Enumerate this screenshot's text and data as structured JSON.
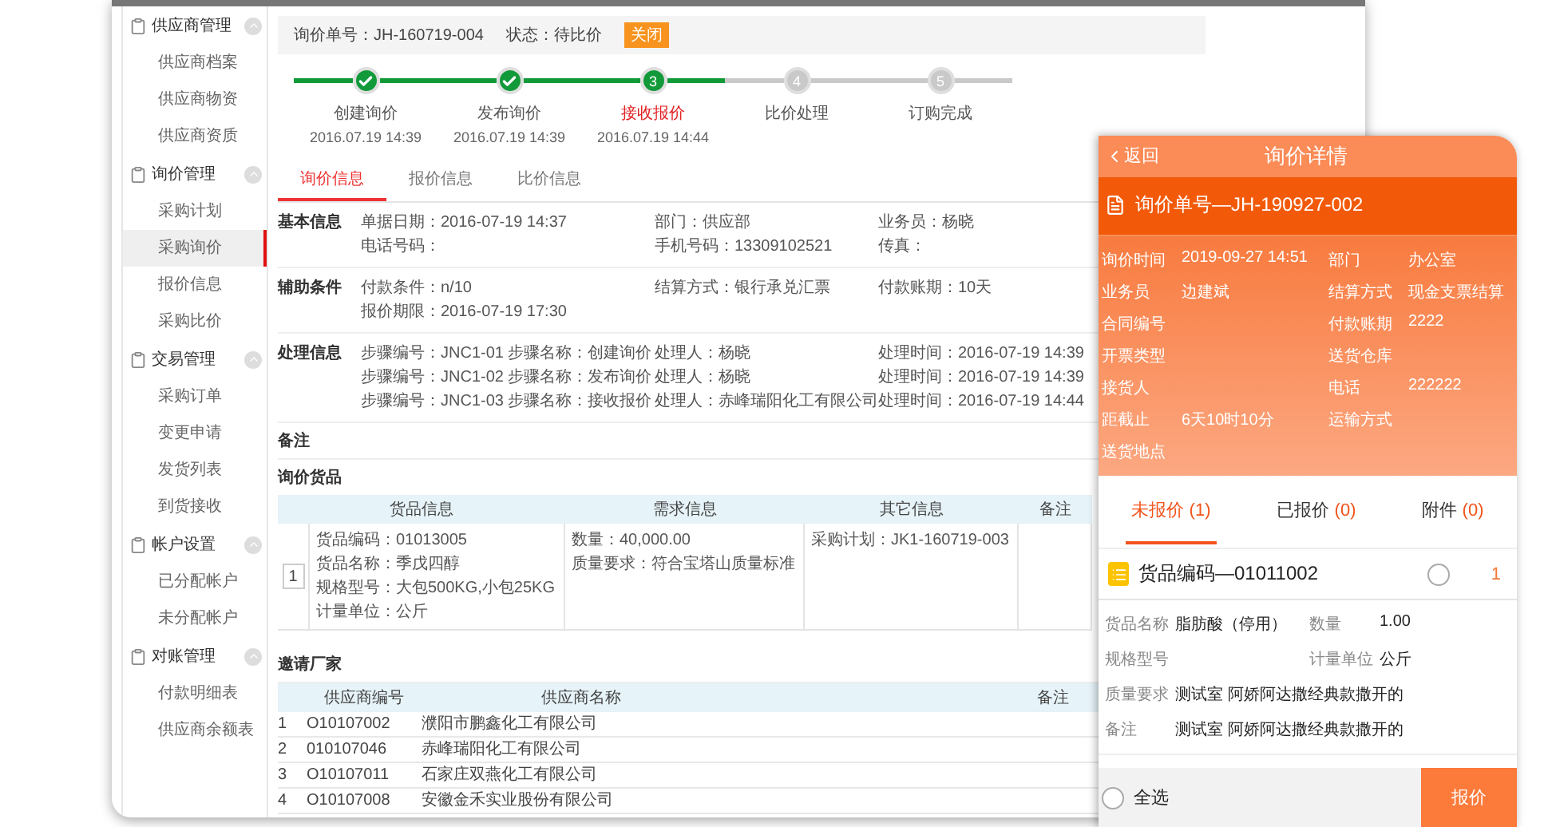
{
  "sidebar": {
    "groups": [
      {
        "title": "供应商管理",
        "expanded": true,
        "items": [
          {
            "label": "供应商档案",
            "selected": false
          },
          {
            "label": "供应商物资",
            "selected": false
          },
          {
            "label": "供应商资质",
            "selected": false
          }
        ]
      },
      {
        "title": "询价管理",
        "expanded": true,
        "items": [
          {
            "label": "采购计划",
            "selected": false
          },
          {
            "label": "采购询价",
            "selected": true
          },
          {
            "label": "报价信息",
            "selected": false
          },
          {
            "label": "采购比价",
            "selected": false
          }
        ]
      },
      {
        "title": "交易管理",
        "expanded": true,
        "items": [
          {
            "label": "采购订单",
            "selected": false
          },
          {
            "label": "变更申请",
            "selected": false
          },
          {
            "label": "发货列表",
            "selected": false
          },
          {
            "label": "到货接收",
            "selected": false
          }
        ]
      },
      {
        "title": "帐户设置",
        "expanded": true,
        "items": [
          {
            "label": "已分配帐户",
            "selected": false
          },
          {
            "label": "未分配帐户",
            "selected": false
          }
        ]
      },
      {
        "title": "对账管理",
        "expanded": true,
        "items": [
          {
            "label": "付款明细表",
            "selected": false
          },
          {
            "label": "供应商余额表",
            "selected": false
          }
        ]
      }
    ]
  },
  "order_bar": {
    "order_no": "询价单号：JH-160719-004",
    "status": "状态：待比价",
    "close_button": "关闭"
  },
  "steps": [
    {
      "done": true,
      "current": false,
      "label": "创建询价",
      "time": "2016.07.19 14:39"
    },
    {
      "done": true,
      "current": false,
      "label": "发布询价",
      "time": "2016.07.19 14:39"
    },
    {
      "done": false,
      "current": true,
      "number": "3",
      "label": "接收报价",
      "time": "2016.07.19 14:44"
    },
    {
      "done": false,
      "current": false,
      "number": "4",
      "label": "比价处理"
    },
    {
      "done": false,
      "current": false,
      "number": "5",
      "label": "订购完成"
    }
  ],
  "tabs": [
    {
      "label": "询价信息",
      "selected": true
    },
    {
      "label": "报价信息",
      "selected": false
    },
    {
      "label": "比价信息",
      "selected": false
    }
  ],
  "sections": [
    {
      "title": "基本信息",
      "kind": "fields",
      "rows": [
        [
          "单据日期：2016-07-19 14:37",
          "部门：供应部",
          "业务员：杨晓"
        ],
        [
          "电话号码：",
          "手机号码：13309102521",
          "传真："
        ]
      ]
    },
    {
      "title": "辅助条件",
      "kind": "fields",
      "rows": [
        [
          "付款条件：n/10",
          "结算方式：银行承兑汇票",
          "付款账期：10天"
        ],
        [
          "报价期限：2016-07-19 17:30"
        ]
      ]
    },
    {
      "title": "处理信息",
      "kind": "steps",
      "rows": [
        [
          "步骤编号：JNC1-01",
          "步骤名称：创建询价",
          "处理人：杨晓",
          "处理时间：2016-07-19 14:39"
        ],
        [
          "步骤编号：JNC1-02",
          "步骤名称：发布询价",
          "处理人：杨晓",
          "处理时间：2016-07-19 14:39"
        ],
        [
          "步骤编号：JNC1-03",
          "步骤名称：接收报价",
          "处理人：赤峰瑞阳化工有限公司",
          "处理时间：2016-07-19 14:44"
        ]
      ]
    }
  ],
  "remarks": {
    "title": "备注"
  },
  "goods": {
    "title": "询价货品",
    "columns": [
      "货品信息",
      "需求信息",
      "其它信息",
      "备注"
    ],
    "rows": [
      {
        "index": "1",
        "goods_info": [
          "货品编码：01013005",
          "货品名称：季戊四醇",
          "规格型号：大包500KG,小包25KG",
          "计量单位：公斤"
        ],
        "demand": [
          "数量：40,000.00",
          "质量要求：符合宝塔山质量标准"
        ],
        "other": [
          "采购计划：JK1-160719-003"
        ]
      }
    ]
  },
  "suppliers": {
    "title": "邀请厂家",
    "columns": [
      "供应商编号",
      "供应商名称",
      "备注"
    ],
    "rows": [
      {
        "index": "1",
        "code": "O10107002",
        "name": "濮阳市鹏鑫化工有限公司"
      },
      {
        "index": "2",
        "code": "010107046",
        "name": "赤峰瑞阳化工有限公司"
      },
      {
        "index": "3",
        "code": "O10107011",
        "name": "石家庄双燕化工有限公司"
      },
      {
        "index": "4",
        "code": "O10107008",
        "name": "安徽金禾实业股份有限公司"
      }
    ]
  },
  "phone": {
    "back": "返回",
    "title": "询价详情",
    "order_no": "询价单号—JH-190927-002",
    "fields": [
      {
        "label": "询价时间",
        "value": "2019-09-27 14:51"
      },
      {
        "label": "部门",
        "value": "办公室"
      },
      {
        "label": "业务员",
        "value": "边建斌"
      },
      {
        "label": "结算方式",
        "value": "现金支票结算"
      },
      {
        "label": "合同编号"
      },
      {
        "label": "付款账期",
        "value": "2222"
      },
      {
        "label": "开票类型"
      },
      {
        "label": "送货仓库"
      },
      {
        "label": "接货人"
      },
      {
        "label": "电话",
        "value": "222222"
      },
      {
        "label": "距截止",
        "value": "6天10时10分"
      },
      {
        "label": "运输方式"
      },
      {
        "label": "送货地点"
      }
    ],
    "tabs": [
      {
        "label": "未报价",
        "count": "(1)",
        "selected": true
      },
      {
        "label": "已报价",
        "count": "(0)",
        "selected": false
      },
      {
        "label": "附件",
        "count": "(0)",
        "selected": false
      }
    ],
    "item": {
      "title": "货品编码—01011002",
      "checked": false,
      "badge": "1",
      "fields": [
        {
          "kind": "pair",
          "label": "货品名称",
          "value": "脂肪酸（停用）"
        },
        {
          "kind": "pair",
          "label": "数量",
          "value": "1.00"
        },
        {
          "kind": "pair",
          "label": "规格型号"
        },
        {
          "kind": "pair",
          "label": "计量单位",
          "value": "公斤"
        },
        {
          "kind": "wide",
          "label": "质量要求",
          "value": "测试室 阿娇阿达撒经典款撒开的"
        },
        {
          "kind": "wide",
          "label": "备注",
          "value": "测试室 阿娇阿达撒经典款撒开的"
        }
      ]
    },
    "select_all": {
      "label": "全选",
      "checked": false
    },
    "quote_button": "报价"
  }
}
